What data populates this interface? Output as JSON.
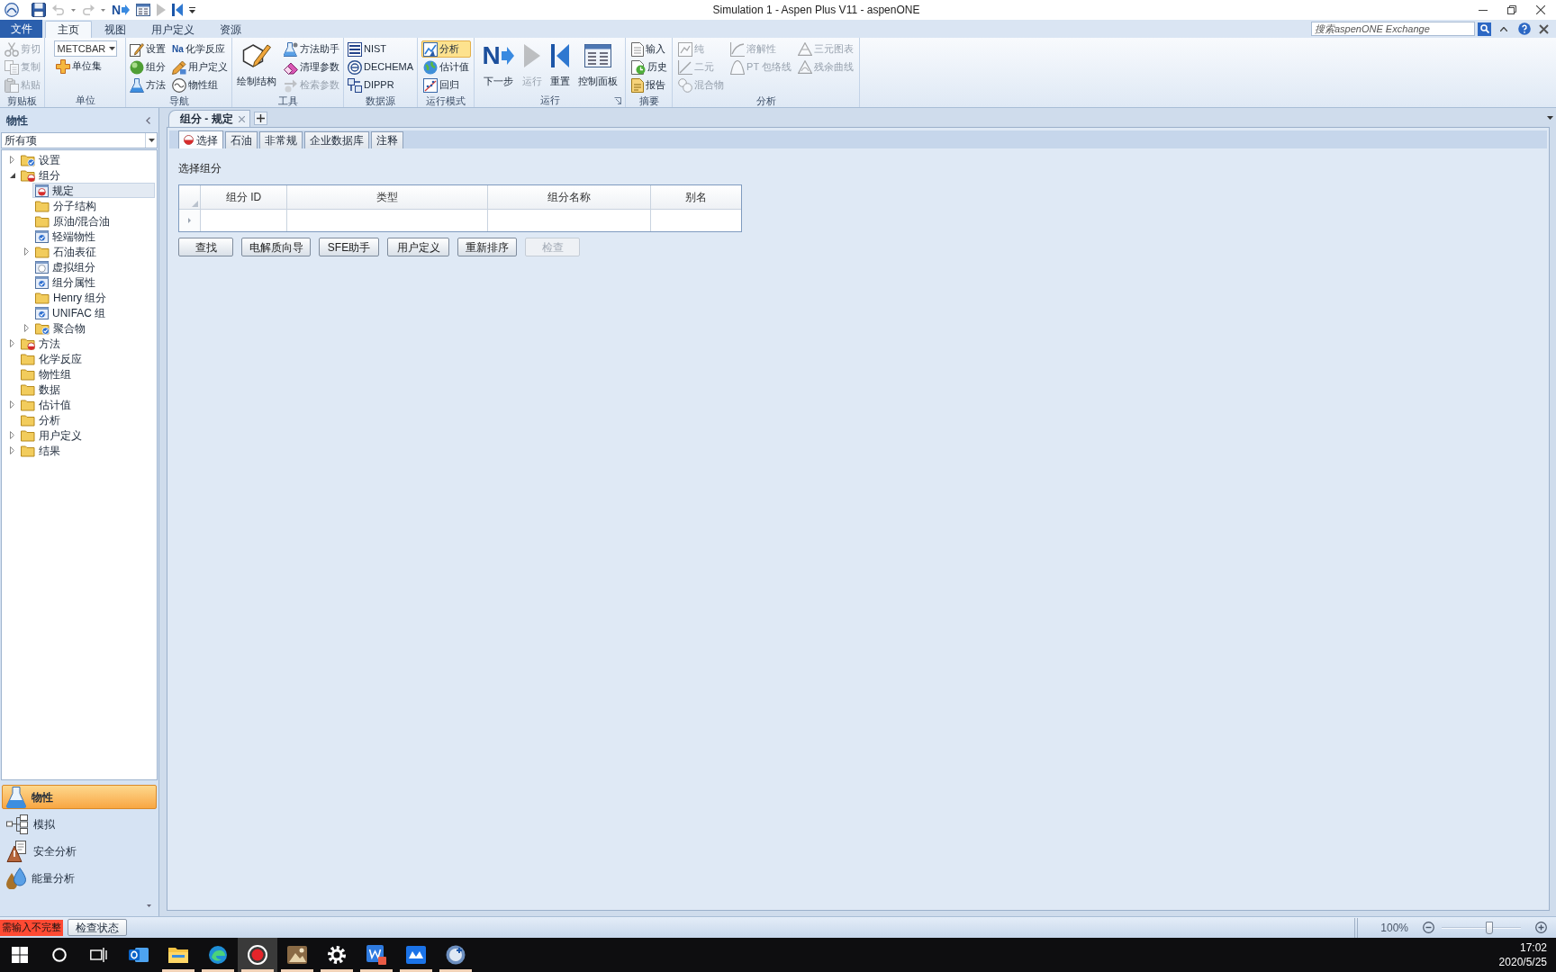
{
  "title_bar": {
    "title": "Simulation 1 - Aspen Plus V11 - aspenONE",
    "quick_access": [
      {
        "disabled": false
      },
      {
        "disabled": true
      },
      {
        "disabled": true
      },
      {
        "disabled": false,
        "icon_text": "N"
      },
      {
        "disabled": false
      },
      {
        "disabled": true
      },
      {
        "disabled": false
      }
    ]
  },
  "ribbon_tabs": [
    {
      "label": "文件",
      "kind": "file",
      "selected": false
    },
    {
      "label": "主页",
      "kind": "tab",
      "selected": true
    },
    {
      "label": "视图",
      "kind": "tab",
      "selected": false
    },
    {
      "label": "用户定义",
      "kind": "tab",
      "selected": false
    },
    {
      "label": "资源",
      "kind": "tab",
      "selected": false
    }
  ],
  "search": {
    "placeholder": "搜索aspenONE Exchange"
  },
  "ribbon_groups": [
    {
      "label": "剪贴板",
      "controls": [
        {
          "kind": "stack",
          "items": [
            {
              "kind": "small",
              "label": "剪切",
              "disabled": true
            },
            {
              "kind": "small",
              "label": "复制",
              "disabled": true
            },
            {
              "kind": "small",
              "label": "粘贴",
              "disabled": true
            }
          ]
        }
      ]
    },
    {
      "label": "单位",
      "controls": [
        {
          "kind": "stack",
          "items": [
            {
              "kind": "dropdown",
              "value": "METCBAR"
            },
            {
              "kind": "small",
              "label": "单位集",
              "disabled": false
            }
          ]
        }
      ]
    },
    {
      "label": "导航",
      "controls": [
        {
          "kind": "stack",
          "items": [
            {
              "kind": "small",
              "label": "设置",
              "disabled": false
            },
            {
              "kind": "small",
              "label": "组分",
              "disabled": false
            },
            {
              "kind": "small",
              "label": "方法",
              "disabled": false
            }
          ]
        },
        {
          "kind": "stack",
          "items": [
            {
              "kind": "small",
              "label": "化学反应",
              "disabled": false,
              "icon_text": "Na"
            },
            {
              "kind": "small",
              "label": "用户定义",
              "disabled": false
            },
            {
              "kind": "small",
              "label": "物性组",
              "disabled": false
            }
          ]
        }
      ]
    },
    {
      "label": "工具",
      "controls": [
        {
          "kind": "large",
          "label": "绘制结构",
          "disabled": false
        },
        {
          "kind": "stack",
          "items": [
            {
              "kind": "small",
              "label": "方法助手",
              "disabled": false
            },
            {
              "kind": "small",
              "label": "清理参数",
              "disabled": false
            },
            {
              "kind": "small",
              "label": "检索参数",
              "disabled": true
            }
          ]
        }
      ]
    },
    {
      "label": "数据源",
      "controls": [
        {
          "kind": "stack",
          "items": [
            {
              "kind": "small",
              "label": "NIST",
              "disabled": false
            },
            {
              "kind": "small",
              "label": "DECHEMA",
              "disabled": false
            },
            {
              "kind": "small",
              "label": "DIPPR",
              "disabled": false
            }
          ]
        }
      ]
    },
    {
      "label": "运行模式",
      "controls": [
        {
          "kind": "stack",
          "items": [
            {
              "kind": "small",
              "label": "分析",
              "disabled": false,
              "selected": true
            },
            {
              "kind": "small",
              "label": "估计值",
              "disabled": false,
              "selected": false
            },
            {
              "kind": "small",
              "label": "回归",
              "disabled": false,
              "selected": false
            }
          ]
        }
      ]
    },
    {
      "label": "运行",
      "launcher": true,
      "controls": [
        {
          "kind": "large",
          "label": "下一步",
          "disabled": false,
          "icon_text": "N"
        },
        {
          "kind": "large",
          "label": "运行",
          "disabled": true
        },
        {
          "kind": "large",
          "label": "重置",
          "disabled": false
        },
        {
          "kind": "large",
          "label": "控制面板",
          "disabled": false
        }
      ]
    },
    {
      "label": "摘要",
      "controls": [
        {
          "kind": "stack",
          "items": [
            {
              "kind": "small",
              "label": "输入",
              "disabled": false
            },
            {
              "kind": "small",
              "label": "历史",
              "disabled": false
            },
            {
              "kind": "small",
              "label": "报告",
              "disabled": false
            }
          ]
        }
      ]
    },
    {
      "label": "分析",
      "controls": [
        {
          "kind": "stack",
          "items": [
            {
              "kind": "small",
              "label": "纯",
              "disabled": true
            },
            {
              "kind": "small",
              "label": "二元",
              "disabled": true
            },
            {
              "kind": "small",
              "label": "混合物",
              "disabled": true
            }
          ]
        },
        {
          "kind": "stack",
          "items": [
            {
              "kind": "small",
              "label": "溶解性",
              "disabled": true
            },
            {
              "kind": "small",
              "label": "PT 包络线",
              "disabled": true
            }
          ]
        },
        {
          "kind": "stack",
          "items": [
            {
              "kind": "small",
              "label": "三元图表",
              "disabled": true
            },
            {
              "kind": "small",
              "label": "残余曲线",
              "disabled": true
            }
          ]
        }
      ]
    }
  ],
  "navigator": {
    "title": "物性",
    "filter": "所有项",
    "tree": [
      {
        "label": "设置",
        "kind": "folder",
        "complete": true,
        "incomplete": false,
        "expanded": false,
        "selected": false
      },
      {
        "label": "组分",
        "kind": "folder",
        "complete": false,
        "incomplete": true,
        "expanded": true,
        "selected": false,
        "children": [
          {
            "label": "规定",
            "kind": "form",
            "complete": false,
            "incomplete": true,
            "selected": true
          },
          {
            "label": "分子结构",
            "kind": "folder",
            "complete": false,
            "incomplete": false,
            "selected": false
          },
          {
            "label": "原油/混合油",
            "kind": "folder",
            "complete": false,
            "incomplete": false,
            "selected": false
          },
          {
            "label": "轻端物性",
            "kind": "form",
            "complete": true,
            "incomplete": false,
            "selected": false
          },
          {
            "label": "石油表征",
            "kind": "folder",
            "complete": false,
            "incomplete": false,
            "expanded": false,
            "selected": false
          },
          {
            "label": "虚拟组分",
            "kind": "form",
            "complete": false,
            "incomplete": false,
            "selected": false
          },
          {
            "label": "组分属性",
            "kind": "form",
            "complete": true,
            "incomplete": false,
            "selected": false
          },
          {
            "label": "Henry 组分",
            "kind": "folder",
            "complete": false,
            "incomplete": false,
            "selected": false
          },
          {
            "label": "UNIFAC 组",
            "kind": "form",
            "complete": true,
            "incomplete": false,
            "selected": false
          },
          {
            "label": "聚合物",
            "kind": "folder",
            "complete": true,
            "incomplete": false,
            "expanded": false,
            "selected": false
          }
        ]
      },
      {
        "label": "方法",
        "kind": "folder",
        "complete": false,
        "incomplete": true,
        "expanded": false,
        "selected": false
      },
      {
        "label": "化学反应",
        "kind": "folder",
        "complete": false,
        "incomplete": false,
        "selected": false
      },
      {
        "label": "物性组",
        "kind": "folder",
        "complete": false,
        "incomplete": false,
        "selected": false
      },
      {
        "label": "数据",
        "kind": "folder",
        "complete": false,
        "incomplete": false,
        "selected": false
      },
      {
        "label": "估计值",
        "kind": "folder",
        "complete": false,
        "incomplete": false,
        "expanded": false,
        "selected": false
      },
      {
        "label": "分析",
        "kind": "folder",
        "complete": false,
        "incomplete": false,
        "selected": false
      },
      {
        "label": "用户定义",
        "kind": "folder",
        "complete": false,
        "incomplete": false,
        "expanded": false,
        "selected": false
      },
      {
        "label": "结果",
        "kind": "folder",
        "complete": false,
        "incomplete": false,
        "expanded": false,
        "selected": false
      }
    ],
    "modules": [
      {
        "label": "物性",
        "selected": true
      },
      {
        "label": "模拟",
        "selected": false
      },
      {
        "label": "安全分析",
        "selected": false
      },
      {
        "label": "能量分析",
        "selected": false
      }
    ]
  },
  "document_tab": {
    "label": "组分 - 规定"
  },
  "form": {
    "tabs": [
      {
        "label": "选择",
        "selected": true,
        "incomplete": true
      },
      {
        "label": "石油",
        "selected": false,
        "incomplete": false
      },
      {
        "label": "非常规",
        "selected": false,
        "incomplete": false
      },
      {
        "label": "企业数据库",
        "selected": false,
        "incomplete": false
      },
      {
        "label": "注释",
        "selected": false,
        "incomplete": false
      }
    ],
    "section_label": "选择组分",
    "table": {
      "columns": [
        "组分 ID",
        "类型",
        "组分名称",
        "别名"
      ]
    },
    "buttons": [
      {
        "label": "查找",
        "disabled": false
      },
      {
        "label": "电解质向导",
        "disabled": false
      },
      {
        "label": "SFE助手",
        "disabled": false
      },
      {
        "label": "用户定义",
        "disabled": false
      },
      {
        "label": "重新排序",
        "disabled": false
      },
      {
        "label": "检查",
        "disabled": true
      }
    ]
  },
  "status_bar": {
    "message": "需输入不完整",
    "check_button": "检查状态",
    "zoom": "100%",
    "zoom_slider": {
      "level": 0.6
    }
  },
  "taskbar": {
    "apps": [
      {
        "running": false,
        "selected": false
      },
      {
        "running": true,
        "selected": false
      },
      {
        "running": true,
        "selected": false
      },
      {
        "running": true,
        "selected": true
      },
      {
        "running": true,
        "selected": false
      },
      {
        "running": true,
        "selected": false
      },
      {
        "running": true,
        "selected": false
      },
      {
        "running": true,
        "selected": false
      },
      {
        "running": true,
        "selected": false
      }
    ],
    "time": "17:02",
    "date": "2020/5/25"
  }
}
